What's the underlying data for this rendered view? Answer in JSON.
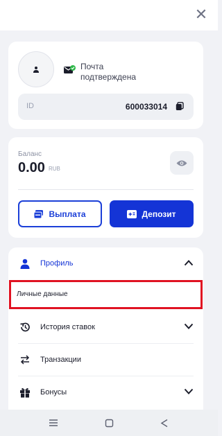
{
  "header": {
    "close_icon": "close-icon"
  },
  "profile": {
    "avatar_icon": "user-icon",
    "email_status_icon": "mail-verified-icon",
    "email_status": "Почта подтверждена",
    "id_label": "ID",
    "id_value": "600033014",
    "copy_icon": "copy-icon"
  },
  "balance": {
    "label": "Баланс",
    "amount": "0.00",
    "currency": "RUB",
    "visibility_icon": "eye-icon",
    "payout_label": "Выплата",
    "payout_icon": "wallet-icon",
    "deposit_label": "Депозит",
    "deposit_icon": "card-plus-icon"
  },
  "menu": {
    "items": [
      {
        "label": "Профиль",
        "icon": "user-icon",
        "expanded": true
      },
      {
        "label": "История ставок",
        "icon": "history-icon",
        "expanded": false
      },
      {
        "label": "Транзакции",
        "icon": "transfer-icon"
      },
      {
        "label": "Бонусы",
        "icon": "gift-icon",
        "expanded": false
      }
    ],
    "subitem": "Личные данные"
  },
  "colors": {
    "accent": "#1434d6",
    "highlight_border": "#e01222",
    "verified": "#2fb84a"
  },
  "navbar": {
    "icons": [
      "menu-nav-icon",
      "home-nav-icon",
      "back-nav-icon"
    ]
  }
}
